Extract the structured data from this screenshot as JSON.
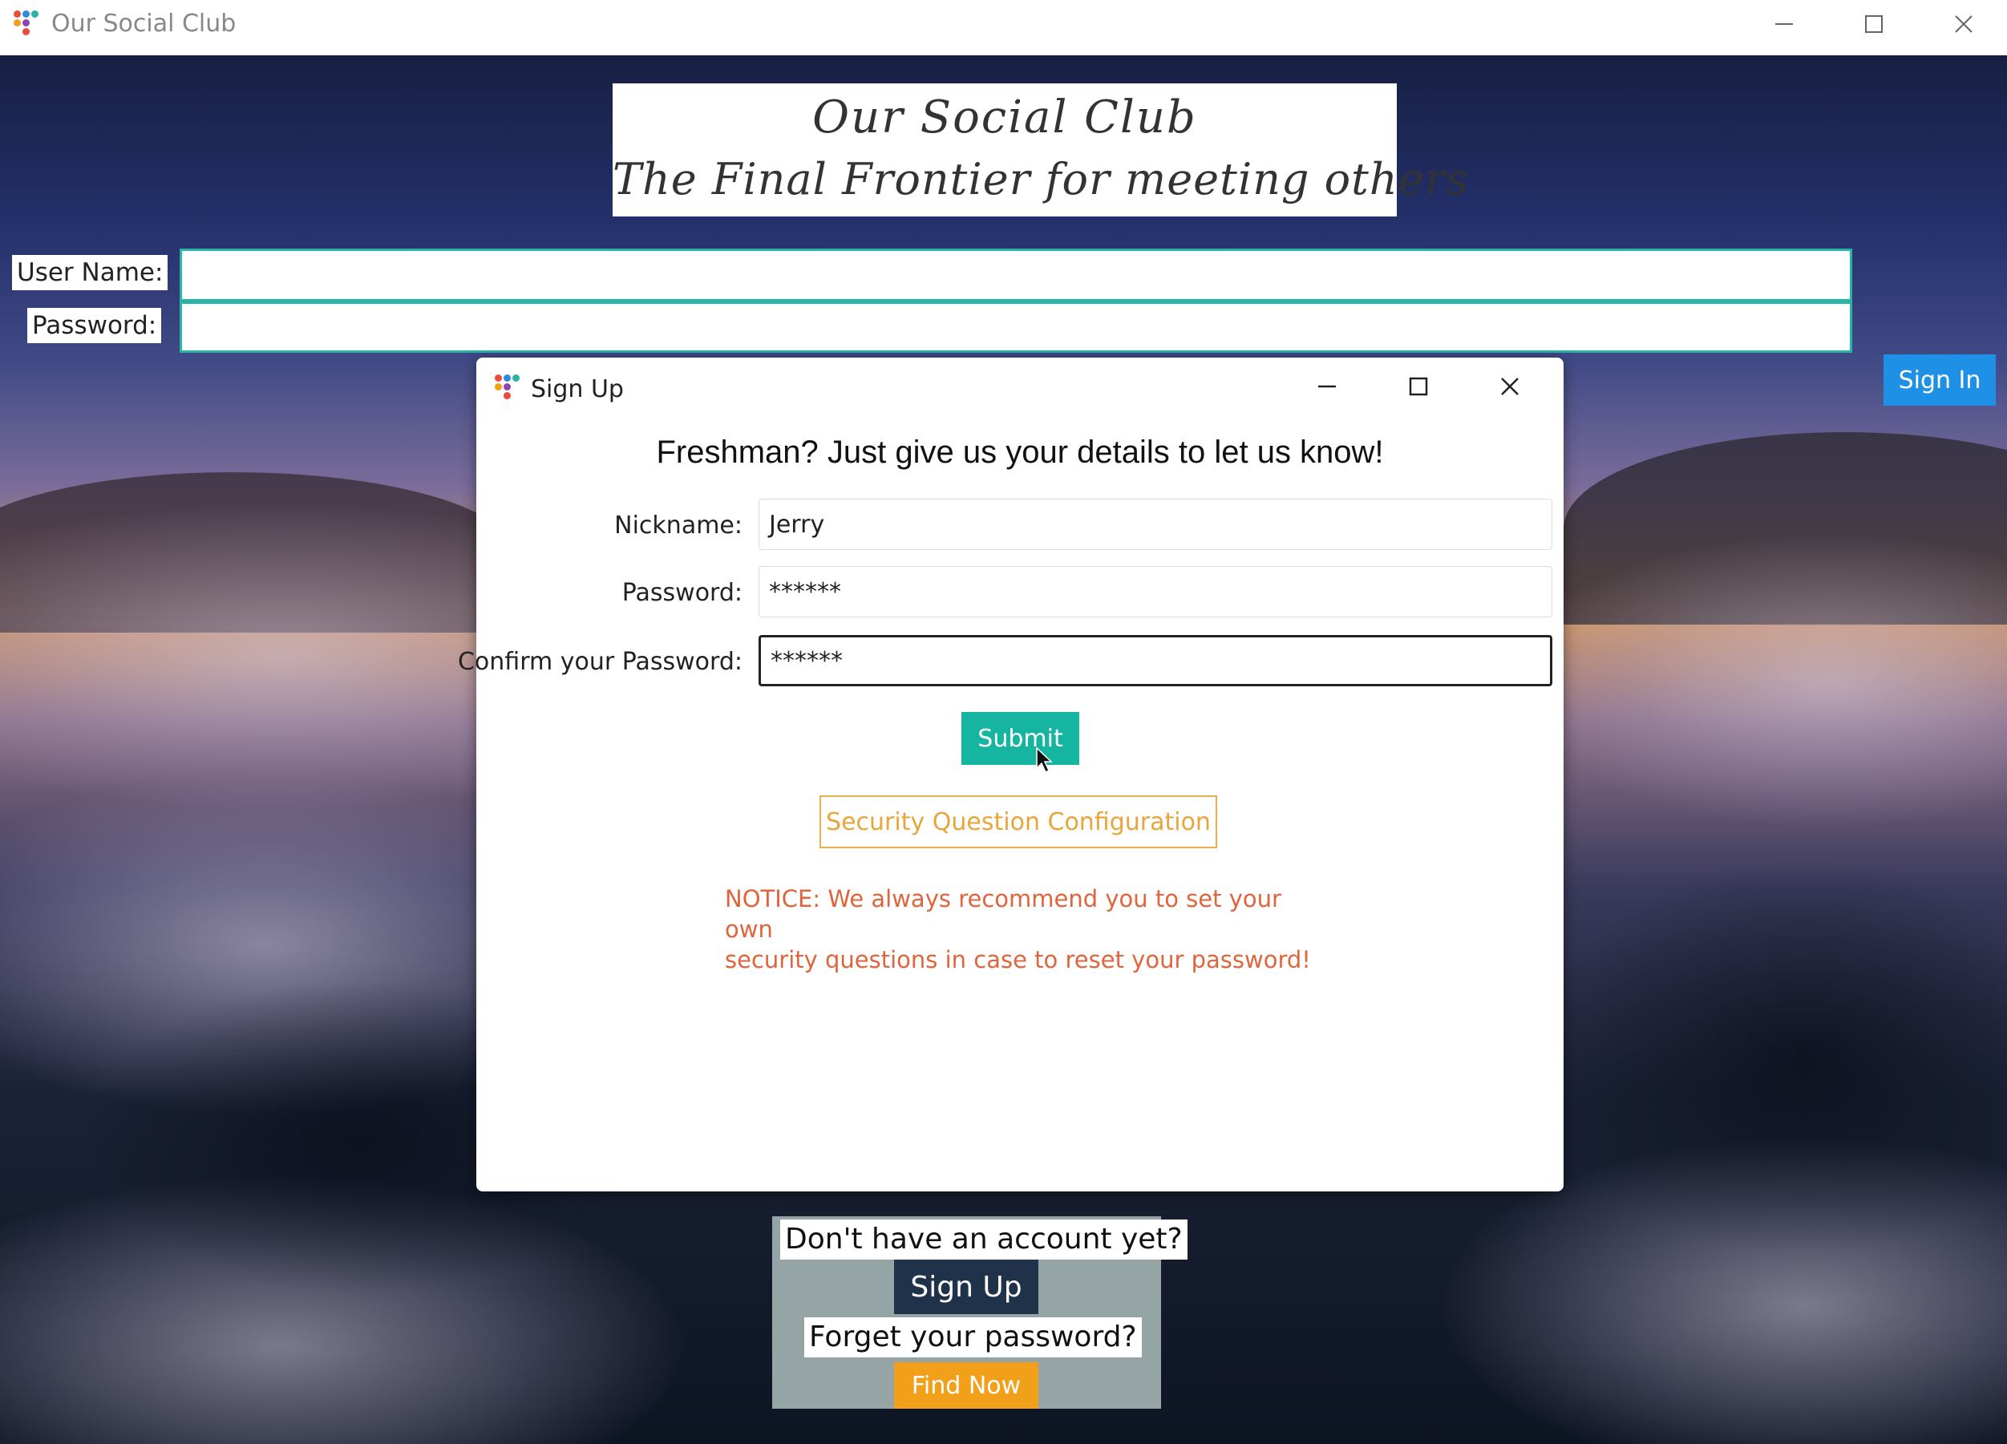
{
  "window": {
    "title": "Our Social Club"
  },
  "banner": {
    "line1": "Our Social Club",
    "line2": "The Final Frontier for meeting others"
  },
  "login": {
    "username_label": "User Name:",
    "username_value": "",
    "password_label": "Password:",
    "password_value": "",
    "signin_label": "Sign In"
  },
  "bottom_panel": {
    "no_account_text": "Don't have an account yet?",
    "signup_label": "Sign Up",
    "forgot_text": "Forget your password?",
    "find_label": "Find Now"
  },
  "dialog": {
    "title": "Sign Up",
    "heading": "Freshman? Just give us your details to let us know!",
    "nickname_label": "Nickname:",
    "nickname_value": "Jerry",
    "password_label": "Password:",
    "password_value": "******",
    "confirm_label": "Confirm your Password:",
    "confirm_value": "******",
    "submit_label": "Submit",
    "security_label": "Security Question Configuration",
    "notice_line1": "NOTICE: We always recommend you to set your own",
    "notice_line2": "security questions in case to reset your password!"
  },
  "colors": {
    "accent_teal": "#16b5a2",
    "signin_blue": "#1e90e6",
    "find_orange": "#f2a019",
    "notice_red": "#e0643c",
    "signup_navy": "#20324a"
  }
}
